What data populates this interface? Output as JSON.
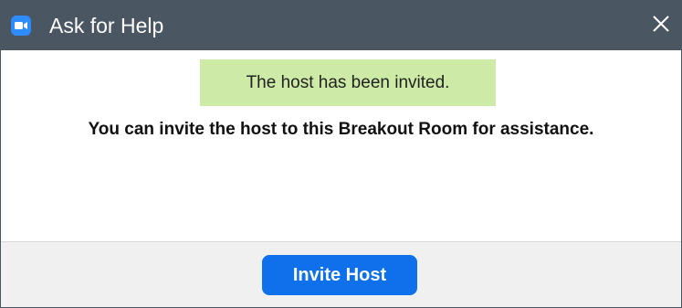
{
  "window": {
    "title": "Ask for Help",
    "icon": "zoom-camera-icon",
    "close_icon": "close-icon",
    "titlebar_color": "#4a5662"
  },
  "notice": {
    "text": "The host has been invited.",
    "background": "#cdeba6"
  },
  "message": {
    "text": "You can invite the host to this Breakout Room for assistance."
  },
  "footer": {
    "invite_button_label": "Invite Host",
    "button_color": "#0e71eb"
  }
}
